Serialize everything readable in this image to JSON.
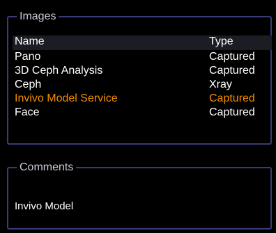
{
  "images": {
    "legend": "Images",
    "columns": {
      "name": "Name",
      "type": "Type"
    },
    "rows": [
      {
        "name": "Pano",
        "type": "Captured"
      },
      {
        "name": "3D Ceph Analysis",
        "type": "Captured"
      },
      {
        "name": "Ceph",
        "type": "Xray"
      },
      {
        "name": "Invivo Model Service",
        "type": "Captured"
      },
      {
        "name": "Face",
        "type": "Captured"
      }
    ],
    "selected_row_color": "#f28c00",
    "header_bg": "#1c1d24"
  },
  "comments": {
    "legend": "Comments",
    "text": "Invivo Model"
  },
  "colors": {
    "border": "#3a3b78",
    "background": "#000000",
    "text": "#ffffff"
  }
}
